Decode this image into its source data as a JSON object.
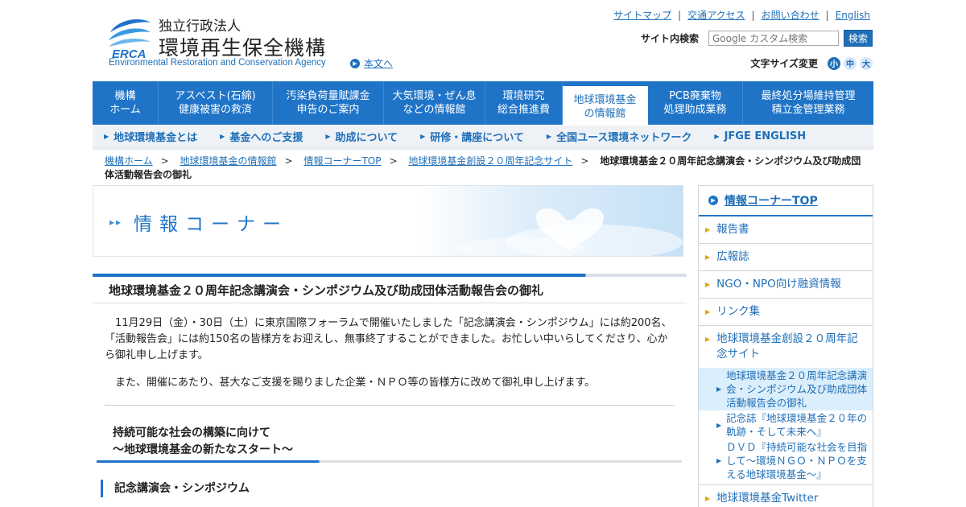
{
  "header": {
    "org_type": "独立行政法人",
    "org_name": "環境再生保全機構",
    "logo_abbr": "ERCA",
    "org_name_en": "Environmental Restoration and Conservation Agency",
    "skip_link": "本文へ",
    "util_links": [
      "サイトマップ",
      "交通アクセス",
      "お問い合わせ",
      "English"
    ],
    "search_label": "サイト内検索",
    "search_placeholder": "Google カスタム検索",
    "search_button": "検索",
    "fontsize_label": "文字サイズ変更",
    "fontsize_small": "小",
    "fontsize_mid": "中",
    "fontsize_large": "大",
    "accent": "#1f74c8"
  },
  "gnav": [
    {
      "l1": "機構",
      "l2": "ホーム"
    },
    {
      "l1": "アスベスト(石綿)",
      "l2": "健康被害の救済"
    },
    {
      "l1": "汚染負荷量賦課金",
      "l2": "申告のご案内"
    },
    {
      "l1": "大気環境・ぜん息",
      "l2": "などの情報館"
    },
    {
      "l1": "環境研究",
      "l2": "総合推進費"
    },
    {
      "l1": "地球環境基金",
      "l2": "の情報館"
    },
    {
      "l1": "PCB廃棄物",
      "l2": "処理助成業務"
    },
    {
      "l1": "最終処分場維持管理",
      "l2": "積立金管理業務"
    }
  ],
  "subnav": [
    "地球環境基金とは",
    "基金へのご支援",
    "助成について",
    "研修・講座について",
    "全国ユース環境ネットワーク",
    "JFGE ENGLISH"
  ],
  "breadcrumb": {
    "links": [
      "機構ホーム",
      "地球環境基金の情報館",
      "情報コーナーTOP",
      "地球環境基金創設２０周年記念サイト"
    ],
    "current": "地球環境基金２０周年記念講演会・シンポジウム及び助成団体活動報告会の御礼"
  },
  "banner": {
    "title": "情報コーナー",
    "arrows": "▸▸"
  },
  "main": {
    "title": "地球環境基金２０周年記念講演会・シンポジウム及び助成団体活動報告会の御礼",
    "para1": "11月29日（金）・30日（土）に東京国際フォーラムで開催いたしました「記念講演会・シンポジウム」には約200名、「活動報告会」には約150名の皆様方をお迎えし、無事終了することができました。お忙しい中いらしてくださり、心から御礼申し上げます。",
    "para2": "また、開催にあたり、甚大なご支援を賜りました企業・ＮＰＯ等の皆様方に改めて御礼申し上げます。",
    "section_title_1": "持続可能な社会の構築に向けて",
    "section_title_2": "～地球環境基金の新たなスタート～",
    "subsection_title": "記念講演会・シンポジウム"
  },
  "side": {
    "head": "情報コーナーTOP",
    "items": [
      "報告書",
      "広報誌",
      "NGO・NPO向け融資情報",
      "リンク集",
      "地球環境基金創設２０周年記念サイト"
    ],
    "subitems": [
      "地球環境基金２０周年記念講演会・シンポジウム及び助成団体活動報告会の御礼",
      "記念誌『地球環境基金２０年の軌跡・そして未来へ』",
      "ＤＶＤ『持続可能な社会を目指して～環境ＮＧＯ・ＮＰＯを支える地球環境基金～』"
    ],
    "last_item": "地球環境基金Twitter"
  }
}
